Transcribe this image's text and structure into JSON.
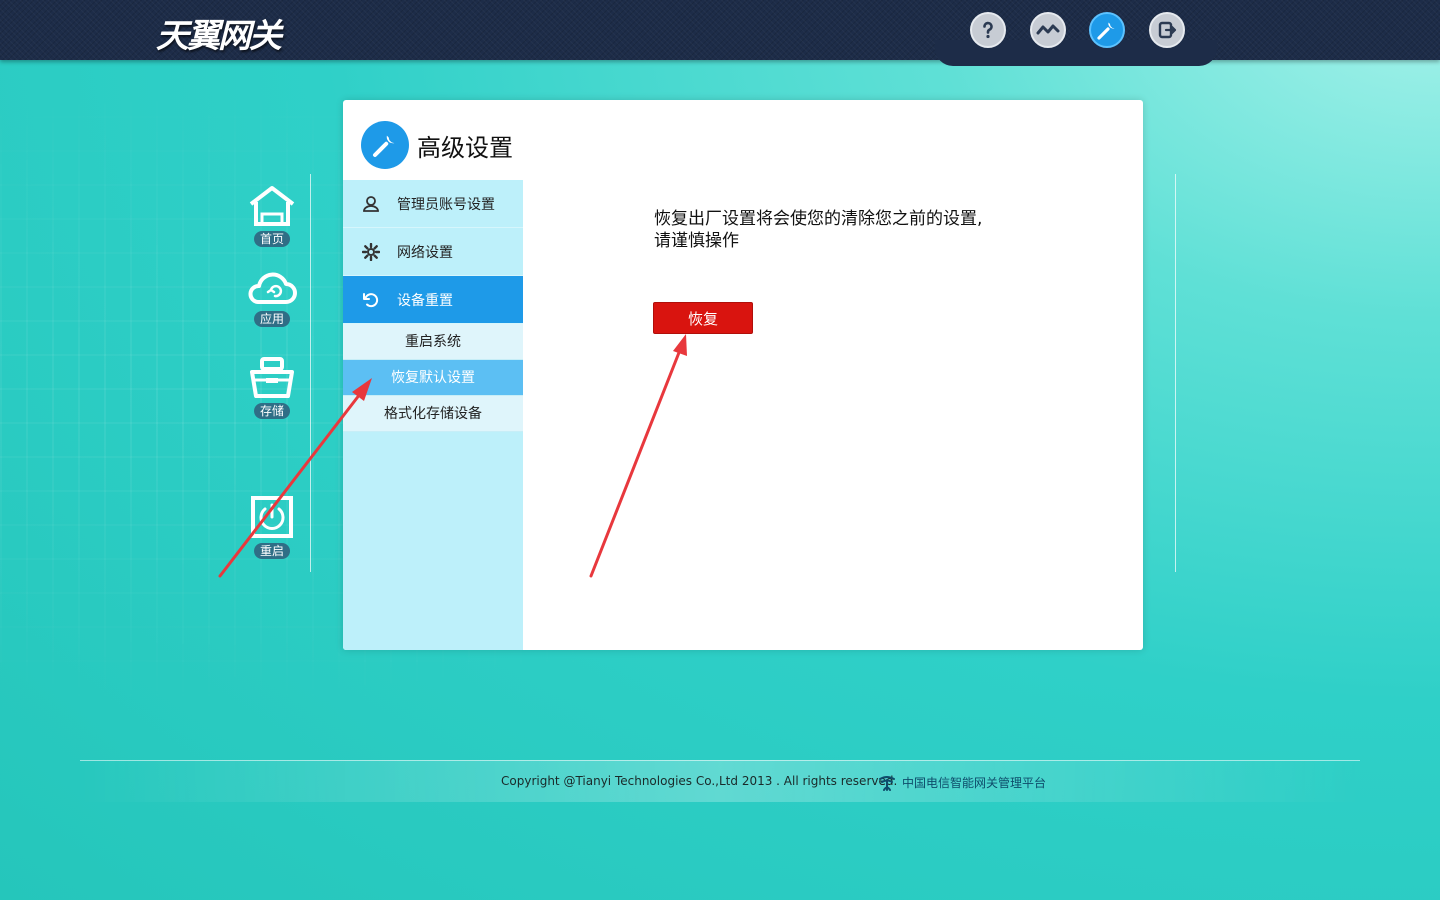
{
  "header": {
    "logo": "天翼网关",
    "icons": [
      {
        "name": "help-icon",
        "active": false
      },
      {
        "name": "status-icon",
        "active": false
      },
      {
        "name": "settings-wrench-icon",
        "active": true
      },
      {
        "name": "logout-icon",
        "active": false
      }
    ]
  },
  "side_nav": {
    "items": [
      {
        "label": "首页",
        "icon": "home-icon"
      },
      {
        "label": "应用",
        "icon": "cloud-icon"
      },
      {
        "label": "存储",
        "icon": "storage-icon"
      },
      {
        "label": "重启",
        "icon": "power-icon"
      }
    ]
  },
  "panel": {
    "title": "高级设置",
    "menu": [
      {
        "label": "管理员账号设置",
        "icon": "user-icon"
      },
      {
        "label": "网络设置",
        "icon": "gear-icon"
      },
      {
        "label": "设备重置",
        "icon": "reset-icon"
      }
    ],
    "submenu": [
      {
        "label": "重启系统"
      },
      {
        "label": "恢复默认设置"
      },
      {
        "label": "格式化存储设备"
      }
    ],
    "message_line1": "恢复出厂设置将会使您的清除您之前的设置,",
    "message_line2": "请谨慎操作",
    "restore_button": "恢复"
  },
  "footer": {
    "copyright": "Copyright @Tianyi Technologies Co.,Ltd 2013 . All rights reserved.",
    "brand": "中国电信智能网关管理平台"
  },
  "colors": {
    "accent": "#1e9ae8",
    "danger": "#d9140f",
    "menu_bg": "#bdf0fa",
    "topbar": "#1d2c48",
    "annotation_arrow": "#e8383d"
  }
}
